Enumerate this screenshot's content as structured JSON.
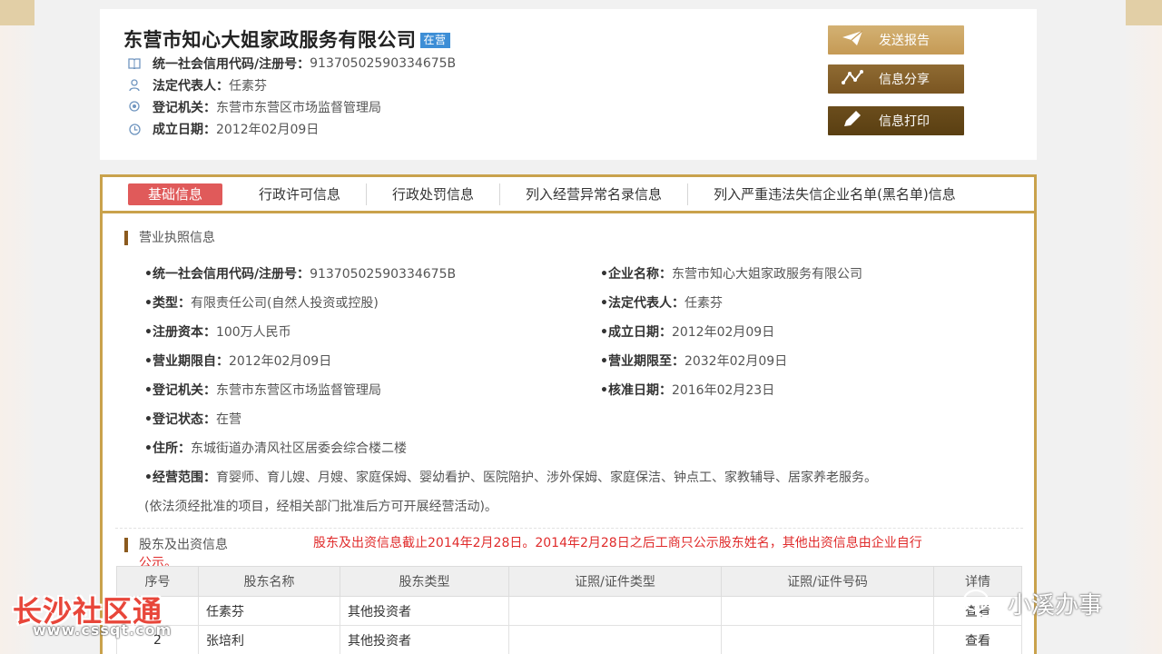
{
  "header": {
    "company_name": "东营市知心大姐家政服务有限公司",
    "status_badge": "在营",
    "rows": [
      {
        "label": "统一社会信用代码/注册号：",
        "value": "91370502590334675B"
      },
      {
        "label": "法定代表人：",
        "value": "任素芬"
      },
      {
        "label": "登记机关：",
        "value": "东营市东营区市场监督管理局"
      },
      {
        "label": "成立日期：",
        "value": "2012年02月09日"
      }
    ],
    "buttons": {
      "report": "发送报告",
      "share": "信息分享",
      "print": "信息打印"
    }
  },
  "tabs": [
    "基础信息",
    "行政许可信息",
    "行政处罚信息",
    "列入经营异常名录信息",
    "列入严重违法失信企业名单(黑名单)信息"
  ],
  "license": {
    "title": "营业执照信息",
    "fields": {
      "credit_code": {
        "label": "•统一社会信用代码/注册号：",
        "value": "91370502590334675B"
      },
      "name": {
        "label": "•企业名称：",
        "value": "东营市知心大姐家政服务有限公司"
      },
      "type": {
        "label": "•类型：",
        "value": "有限责任公司(自然人投资或控股)"
      },
      "legal_rep": {
        "label": "•法定代表人：",
        "value": "任素芬"
      },
      "capital": {
        "label": "•注册资本：",
        "value": "100万人民币"
      },
      "established": {
        "label": "•成立日期：",
        "value": "2012年02月09日"
      },
      "term_from": {
        "label": "•营业期限自：",
        "value": "2012年02月09日"
      },
      "term_to": {
        "label": "•营业期限至：",
        "value": "2032年02月09日"
      },
      "authority": {
        "label": "•登记机关：",
        "value": "东营市东营区市场监督管理局"
      },
      "approved": {
        "label": "•核准日期：",
        "value": "2016年02月23日"
      },
      "reg_status": {
        "label": "•登记状态：",
        "value": "在营"
      },
      "address": {
        "label": "•住所：",
        "value": "东城街道办清风社区居委会综合楼二楼"
      },
      "scope": {
        "label": "•经营范围：",
        "value": "育婴师、育儿嫂、月嫂、家庭保姆、婴幼看护、医院陪护、涉外保姆、家庭保洁、钟点工、家教辅导、居家养老服务。"
      },
      "scope_note": "(依法须经批准的项目，经相关部门批准后方可开展经营活动)。"
    }
  },
  "shareholders": {
    "title": "股东及出资信息",
    "notice": "股东及出资信息截止2014年2月28日。2014年2月28日之后工商只公示股东姓名，其他出资信息由企业自行",
    "notice_cont": "公示。",
    "columns": [
      "序号",
      "股东名称",
      "股东类型",
      "证照/证件类型",
      "证照/证件号码",
      "详情"
    ],
    "rows": [
      {
        "no": "1",
        "name": "任素芬",
        "type": "其他投资者",
        "id_type": "",
        "id_no": "",
        "detail": "查看"
      },
      {
        "no": "2",
        "name": "张培利",
        "type": "其他投资者",
        "id_type": "",
        "id_no": "",
        "detail": "查看"
      }
    ]
  },
  "watermarks": {
    "left": "长沙社区通",
    "left_sub": "www.cssqt.com",
    "right": "小溪办事"
  }
}
